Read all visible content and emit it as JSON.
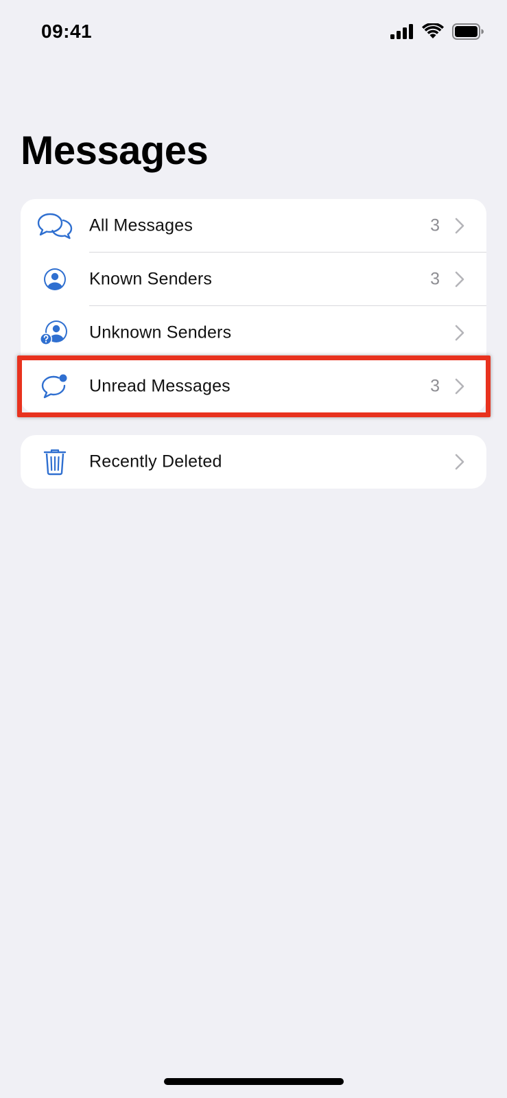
{
  "status_bar": {
    "time": "09:41"
  },
  "page": {
    "title": "Messages"
  },
  "main_group": {
    "items": [
      {
        "label": "All Messages",
        "count": "3",
        "icon": "chat-bubbles-icon"
      },
      {
        "label": "Known Senders",
        "count": "3",
        "icon": "person-circle-icon"
      },
      {
        "label": "Unknown Senders",
        "count": "",
        "icon": "unknown-person-icon"
      },
      {
        "label": "Unread Messages",
        "count": "3",
        "icon": "unread-bubble-icon"
      }
    ]
  },
  "deleted_group": {
    "items": [
      {
        "label": "Recently Deleted",
        "count": "",
        "icon": "trash-icon"
      }
    ]
  },
  "colors": {
    "accent": "#2f6fd0",
    "background": "#f0f0f5",
    "highlight": "#e8321e"
  }
}
